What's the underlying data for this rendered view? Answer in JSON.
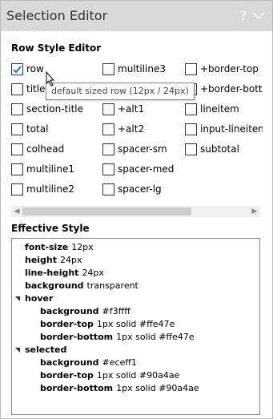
{
  "window": {
    "title": "Selection Editor",
    "help_icon": "?",
    "collapse_icon": "chevron-down-icon"
  },
  "row_style": {
    "heading": "Row Style Editor",
    "options": [
      {
        "label": "row",
        "checked": true
      },
      {
        "label": "multiline3",
        "checked": false
      },
      {
        "label": "+border-top",
        "checked": false
      },
      {
        "label": "title",
        "checked": false
      },
      {
        "label": "",
        "checked": false
      },
      {
        "label": "+border-bottom",
        "checked": false
      },
      {
        "label": "section-title",
        "checked": false
      },
      {
        "label": "+alt1",
        "checked": false
      },
      {
        "label": "lineitem",
        "checked": false
      },
      {
        "label": "total",
        "checked": false
      },
      {
        "label": "+alt2",
        "checked": false
      },
      {
        "label": "input-lineitem",
        "checked": false
      },
      {
        "label": "colhead",
        "checked": false
      },
      {
        "label": "spacer-sm",
        "checked": false
      },
      {
        "label": "subtotal",
        "checked": false
      },
      {
        "label": "multiline1",
        "checked": false
      },
      {
        "label": "spacer-med",
        "checked": false
      },
      {
        "label": "multiline2",
        "checked": false
      },
      {
        "label": "spacer-lg",
        "checked": false
      }
    ],
    "tooltip": "default sized row (12px / 24px)"
  },
  "effective_style": {
    "heading": "Effective Style",
    "base": [
      {
        "key": "font-size",
        "value": "12px"
      },
      {
        "key": "height",
        "value": "24px"
      },
      {
        "key": "line-height",
        "value": "24px"
      },
      {
        "key": "background",
        "value": "transparent"
      }
    ],
    "groups": [
      {
        "name": "hover",
        "props": [
          {
            "key": "background",
            "value": "#f3ffff"
          },
          {
            "key": "border-top",
            "value": "1px solid #ffe47e"
          },
          {
            "key": "border-bottom",
            "value": "1px solid #ffe47e"
          }
        ]
      },
      {
        "name": "selected",
        "props": [
          {
            "key": "background",
            "value": "#eceff1"
          },
          {
            "key": "border-top",
            "value": "1px solid #90a4ae"
          },
          {
            "key": "border-bottom",
            "value": "1px solid #90a4ae"
          }
        ]
      }
    ]
  }
}
